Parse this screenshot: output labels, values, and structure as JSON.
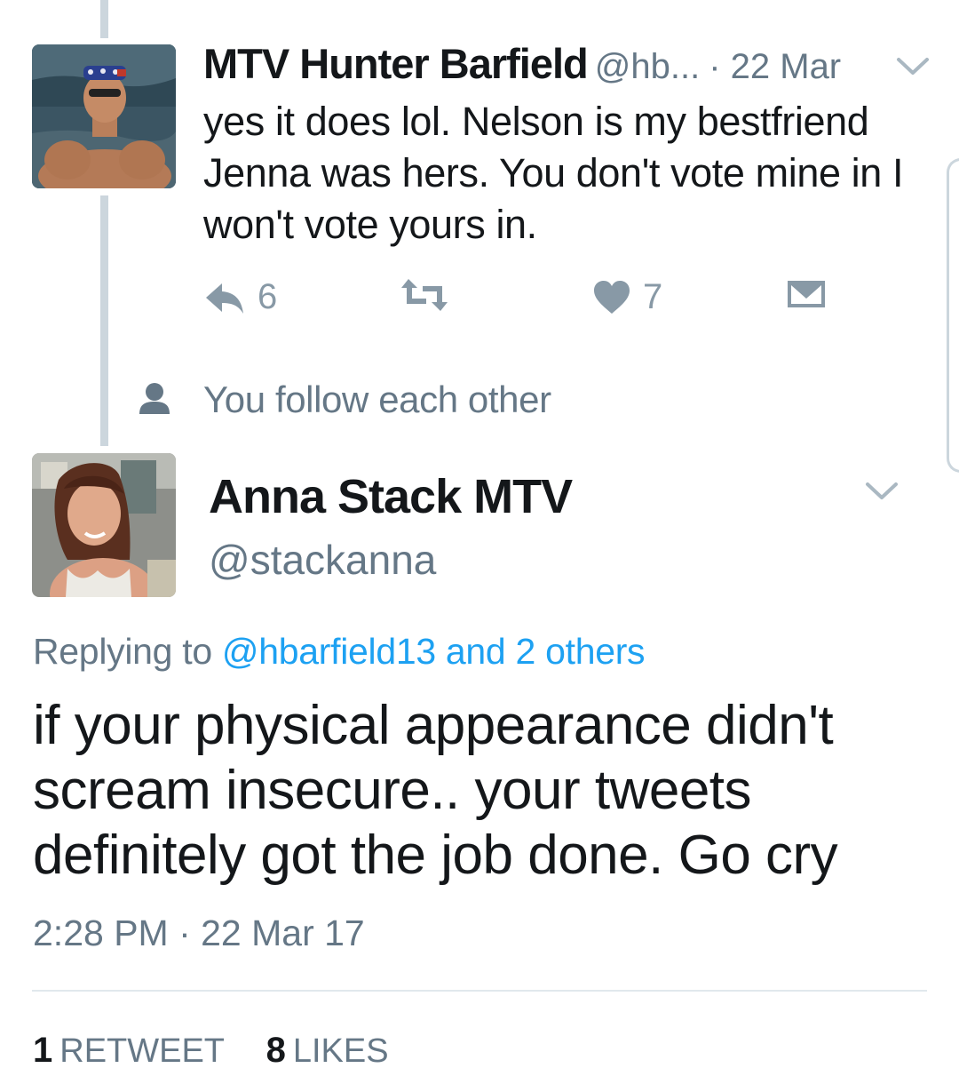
{
  "tweet1": {
    "name": "MTV Hunter Barfield",
    "handle": "@hb...",
    "time": "· 22 Mar",
    "text": "yes it does lol. Nelson is my bestfriend Jenna was hers. You don't vote mine in I won't vote yours in.",
    "reply_count": "6",
    "like_count": "7",
    "icons": [
      "reply-icon",
      "retweet-icon",
      "heart-icon",
      "envelope-icon",
      "chevron-down-icon"
    ],
    "action_color": "#8899a6"
  },
  "social_context": {
    "text": "You follow each other",
    "icon": "person-icon"
  },
  "tweet2": {
    "name": "Anna Stack MTV",
    "handle": "@stackanna",
    "replying_prefix": "Replying to",
    "replying_link": "@hbarfield13 and 2 others",
    "text": "if your physical appearance didn't scream insecure.. your tweets definitely got the job done. Go cry",
    "timestamp": "2:28 PM · 22 Mar 17",
    "retweets_count": "1",
    "retweets_label": "RETWEET",
    "likes_count": "8",
    "likes_label": "LIKES"
  },
  "colors": {
    "link": "#1da1f2",
    "secondary_text": "#657786",
    "primary_text": "#14171a",
    "thread_line": "#ccd6dd"
  }
}
